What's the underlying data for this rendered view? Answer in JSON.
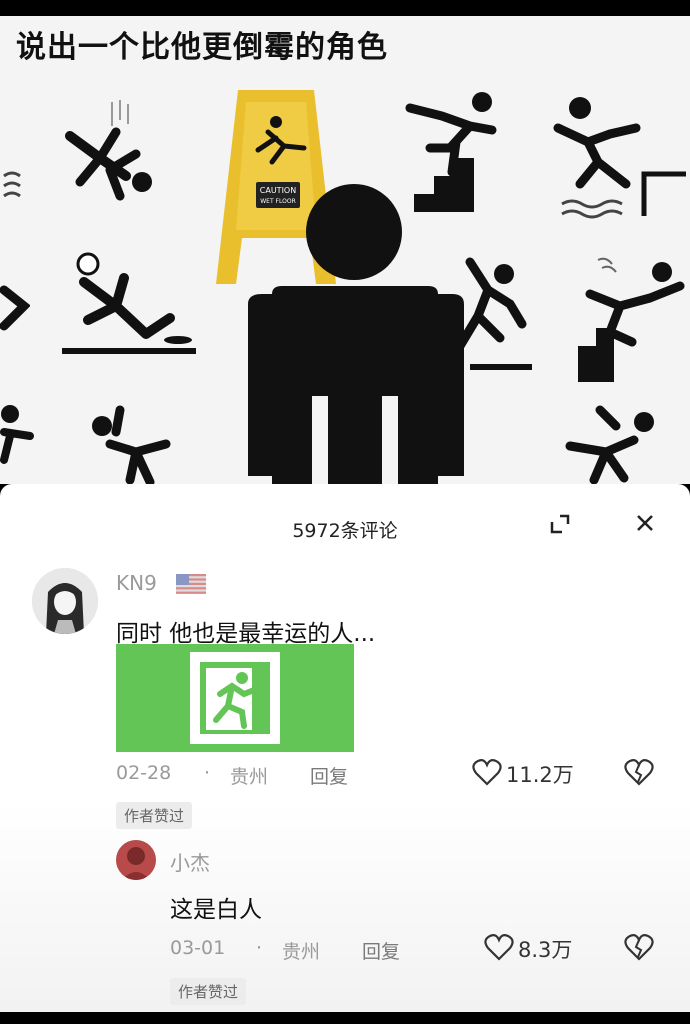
{
  "post": {
    "title": "说出一个比他更倒霉的角色"
  },
  "comments_panel": {
    "title": "5972条评论"
  },
  "comments": [
    {
      "username": "KN9",
      "flag": "us-flag",
      "text": "同时 他也是最幸运的人...",
      "date": "02-28",
      "location": "贵州",
      "reply_label": "回复",
      "likes": "11.2万",
      "badge": "作者赞过"
    }
  ],
  "replies": [
    {
      "username": "小杰",
      "text": "这是白人",
      "date": "03-01",
      "location": "贵州",
      "reply_label": "回复",
      "likes": "8.3万",
      "badge": "作者赞过"
    }
  ],
  "sign": {
    "line1": "CAUTION",
    "line2": "WET FLOOR"
  },
  "separator": "·",
  "colors": {
    "exit_green": "#62c556",
    "sign_yellow": "#e9bf2e"
  }
}
